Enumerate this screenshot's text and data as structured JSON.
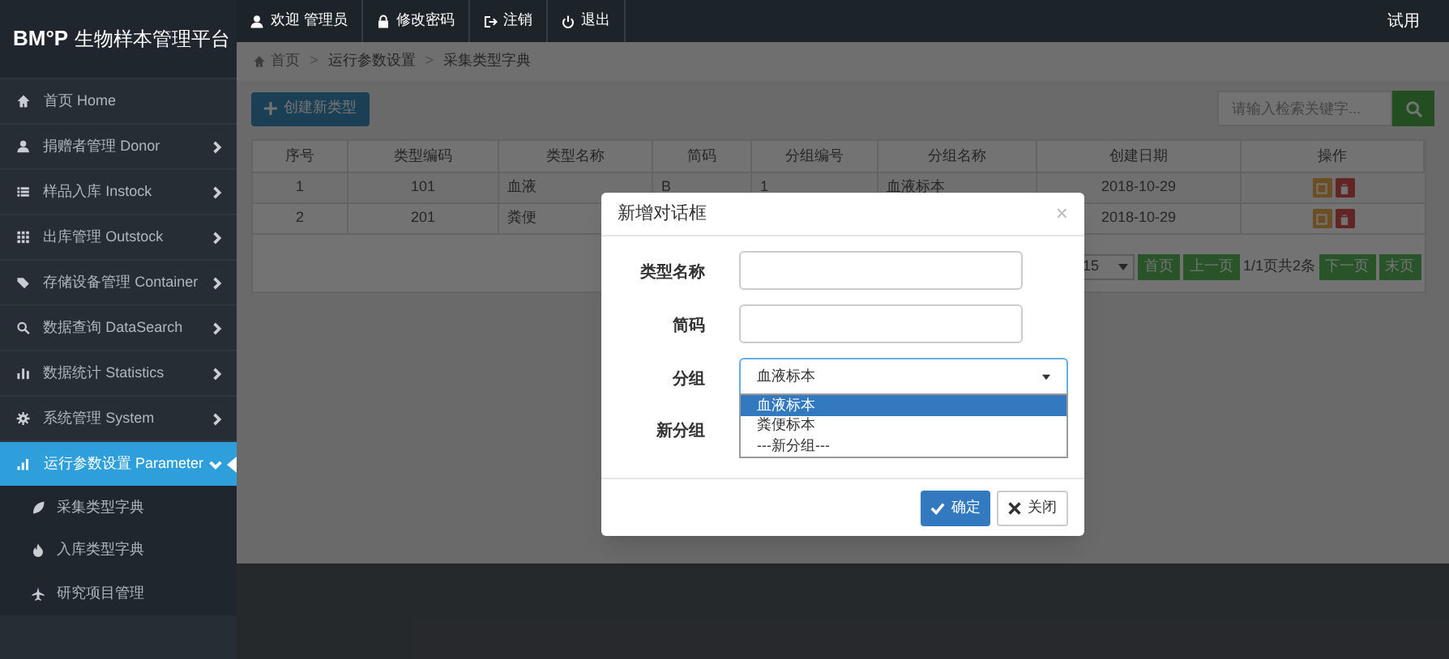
{
  "app": {
    "logo": "BM°P",
    "title": "生物样本管理平台"
  },
  "top_nav": [
    {
      "label": "欢迎 管理员"
    },
    {
      "label": "修改密码"
    },
    {
      "label": "注销"
    },
    {
      "label": "退出"
    }
  ],
  "top_right": "试用",
  "sidebar": {
    "items": [
      {
        "label": "首页 Home",
        "selected": false
      },
      {
        "label": "捐赠者管理 Donor",
        "selected": false,
        "expanded": false
      },
      {
        "label": "样品入库 Instock",
        "selected": false,
        "expanded": false
      },
      {
        "label": "出库管理 Outstock",
        "selected": false,
        "expanded": false
      },
      {
        "label": "存储设备管理 Container",
        "selected": false,
        "expanded": false
      },
      {
        "label": "数据查询 DataSearch",
        "selected": false,
        "expanded": false
      },
      {
        "label": "数据统计 Statistics",
        "selected": false,
        "expanded": false
      },
      {
        "label": "系统管理 System",
        "selected": false,
        "expanded": false
      },
      {
        "label": "运行参数设置 Parameter",
        "selected": true,
        "expanded": true,
        "children": [
          {
            "label": "采集类型字典"
          },
          {
            "label": "入库类型字典"
          },
          {
            "label": "研究项目管理"
          }
        ]
      }
    ]
  },
  "breadcrumb": [
    {
      "kind": "home",
      "label": "首页"
    },
    {
      "kind": "separator",
      "label": ">"
    },
    {
      "kind": "link",
      "label": "运行参数设置"
    },
    {
      "kind": "separator",
      "label": ">"
    },
    {
      "kind": "current",
      "label": "采集类型字典"
    }
  ],
  "create_button": "创建新类型",
  "search": {
    "placeholder": "请输入检索关键字..."
  },
  "table": {
    "columns": [
      "序号",
      "类型编码",
      "类型名称",
      "简码",
      "分组编号",
      "分组名称",
      "创建日期",
      "操作"
    ],
    "rows": [
      [
        "1",
        "101",
        "血液",
        "B",
        "1",
        "血液标本",
        "2018-10-29"
      ],
      [
        "2",
        "201",
        "粪便",
        null,
        null,
        null,
        "2018-10-29"
      ]
    ]
  },
  "pagination": {
    "page_size": "15",
    "first": "首页",
    "prev": "上一页",
    "info": "1/1页共2条",
    "next": "下一页",
    "last": "末页"
  },
  "dialog": {
    "title": "新增对话框",
    "close": "×",
    "fields": [
      {
        "label": "类型名称",
        "kind": "text"
      },
      {
        "label": "简码",
        "kind": "text"
      },
      {
        "label": "分组",
        "kind": "select",
        "value": "血液标本",
        "options": [
          {
            "label": "血液标本",
            "selected": true
          },
          {
            "label": "粪便标本",
            "selected": false
          },
          {
            "label": "---新分组---",
            "selected": false
          }
        ]
      },
      {
        "label": "新分组"
      }
    ],
    "buttons": [
      {
        "label": "确定",
        "kind": "primary"
      },
      {
        "label": "关闭",
        "kind": "default"
      }
    ]
  }
}
